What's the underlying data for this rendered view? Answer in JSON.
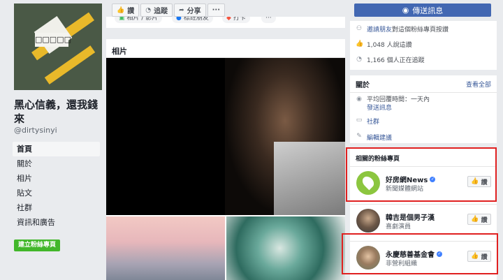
{
  "page": {
    "name": "黑心信義，還我錢來",
    "handle": "@dirtysinyi",
    "cover_sign": "□□□□□",
    "create_button": "建立粉絲專頁"
  },
  "nav": [
    "首頁",
    "關於",
    "相片",
    "貼文",
    "社群",
    "資訊和廣告"
  ],
  "actions": {
    "like": "讚",
    "follow": "追蹤",
    "share": "分享",
    "more": "···",
    "send_message": "傳送訊息"
  },
  "partial_row": {
    "chip1": "相片 / 影片",
    "chip2": "標註朋友",
    "chip3": "打卡",
    "chip4": "···"
  },
  "photos": {
    "title": "相片"
  },
  "community": {
    "invite_link": "邀請朋友",
    "invite_text": "對這個粉絲專頁按讚",
    "likes": "1,048 人說這讚",
    "follows": "1,166 個人正在追蹤"
  },
  "about": {
    "title": "關於",
    "see_all": "查看全部",
    "response_time": "平均回覆時間：一天內",
    "send_message": "發送訊息",
    "category": "社群",
    "suggest_edit": "編輯建議"
  },
  "related": {
    "title": "相關的粉絲專頁",
    "like_label": "讚",
    "items": [
      {
        "name": "好房網News",
        "sub": "新聞媒體網站",
        "verified": true
      },
      {
        "name": "韓吉是個男子漢",
        "sub": "喜劇演員",
        "verified": false
      },
      {
        "name": "永慶慈善基金會",
        "sub": "非營利組織",
        "verified": true
      }
    ]
  },
  "colors": {
    "brand_blue": "#4267b2",
    "link_blue": "#385898",
    "green": "#42b72a",
    "highlight_red": "#e02020"
  }
}
